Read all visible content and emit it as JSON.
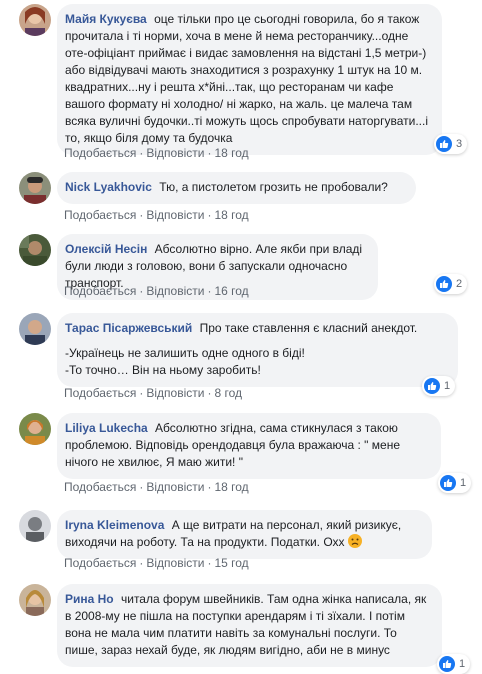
{
  "actions": {
    "like": "Подобається",
    "reply": "Відповісти",
    "separator": "·"
  },
  "comments": [
    {
      "author": "Майя Кукуєва",
      "text": "оце тільки про це сьогодні говорила, бо я також прочитала і ті норми, хоча в мене й нема ресторанчику...одне оте-офіціант приймає і видає замовлення на відстані 1,5 метри-) або відвідувачі мають знаходитися з розрахунку 1 штук на 10 м. квадратних...ну і решта х*йні...так, що ресторанам чи кафе вашого формату ні холодно/ ні жарко, на жаль. це малеча там всяка вуличні будочки..ті можуть щось спробувати наторгувати...і то, якщо біля дому та будочка",
      "time": "18 год",
      "reactions": "3"
    },
    {
      "author": "Nick Lyakhovic",
      "text": "Тю, а пистолетом грозить не пробовали?",
      "time": "18 год",
      "reactions": ""
    },
    {
      "author": "Олексій Несін",
      "text": "Абсолютно вірно. Але якби при владі були люди з головою, вони б запускали одночасно транспорт.",
      "time": "16 год",
      "reactions": "2"
    },
    {
      "author": "Тарас Пісаржевський",
      "text": "Про таке ставлення є класний анекдот.",
      "text_line2": "-Українець не залишить одне одного в біді!",
      "text_line3": "-То точно… Він на ньому заробить!",
      "time": "8 год",
      "reactions": "1"
    },
    {
      "author": "Liliya Lukecha",
      "text": "Абсолютно згідна, сама стикнулася з такою проблемою. Відповідь орендодавця була вражаюча : \" мене нічого не хвилює, Я маю жити! \"",
      "time": "18 год",
      "reactions": "1"
    },
    {
      "author": "Iryna Kleimenova",
      "text": "А ще витрати на персонал, який ризикує, виходячи на роботу. Та на продукти. Податки. Охх",
      "time": "15 год",
      "reactions": ""
    },
    {
      "author": "Рина Но",
      "text": "читала форум швейників. Там одна жінка написала, як в 2008-му не пішла на поступки арендарям і ті зїхали. І потім вона не мала чим платити навіть за комунальні послуги. То пише, зараз нехай буде, як людям вигідно, аби не в минус",
      "time": "",
      "reactions": "1"
    }
  ],
  "colors": {
    "link": "#385898",
    "like": "#1877f2",
    "bubble": "#f2f3f5"
  }
}
